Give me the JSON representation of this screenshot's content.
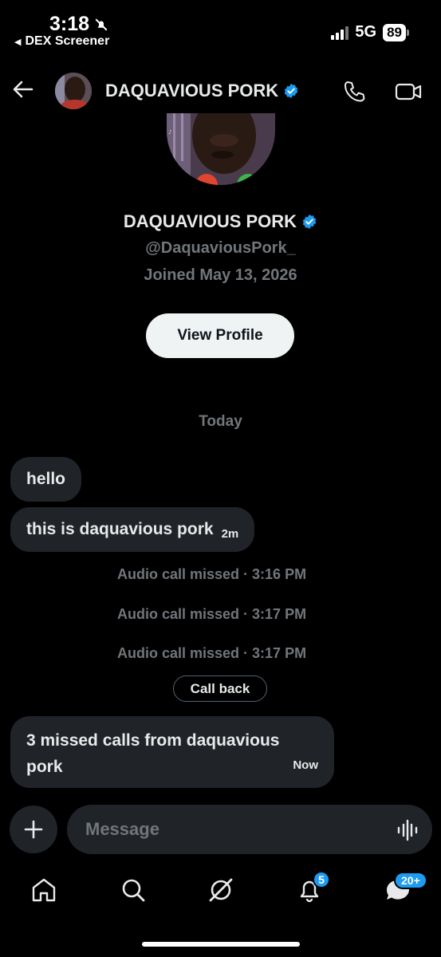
{
  "status_bar": {
    "time": "3:18",
    "back_app": "DEX Screener",
    "network": "5G",
    "battery": "89"
  },
  "header": {
    "name": "DAQUAVIOUS PORK"
  },
  "profile": {
    "name": "DAQUAVIOUS PORK",
    "handle": "@DaquaviousPork_",
    "joined": "Joined May 13, 2026",
    "view_profile_label": "View Profile"
  },
  "conversation": {
    "date_separator": "Today",
    "messages": [
      {
        "text": "hello"
      },
      {
        "text": "this is daquavious pork",
        "time": "2m"
      }
    ],
    "system_events": [
      {
        "text": "Audio call missed · 3:16 PM"
      },
      {
        "text": "Audio call missed · 3:17 PM"
      },
      {
        "text": "Audio call missed · 3:17 PM"
      }
    ],
    "call_back_label": "Call back",
    "last_message": {
      "text": "3 missed calls from daquavious pork",
      "time": "Now"
    }
  },
  "composer": {
    "placeholder": "Message"
  },
  "tab_bar": {
    "notifications_badge": "5",
    "messages_badge": "20+"
  },
  "colors": {
    "background": "#000000",
    "bubble": "#202327",
    "muted_text": "#71767b",
    "accent_blue": "#1d9bf0",
    "verified": "#1d9bf0"
  }
}
